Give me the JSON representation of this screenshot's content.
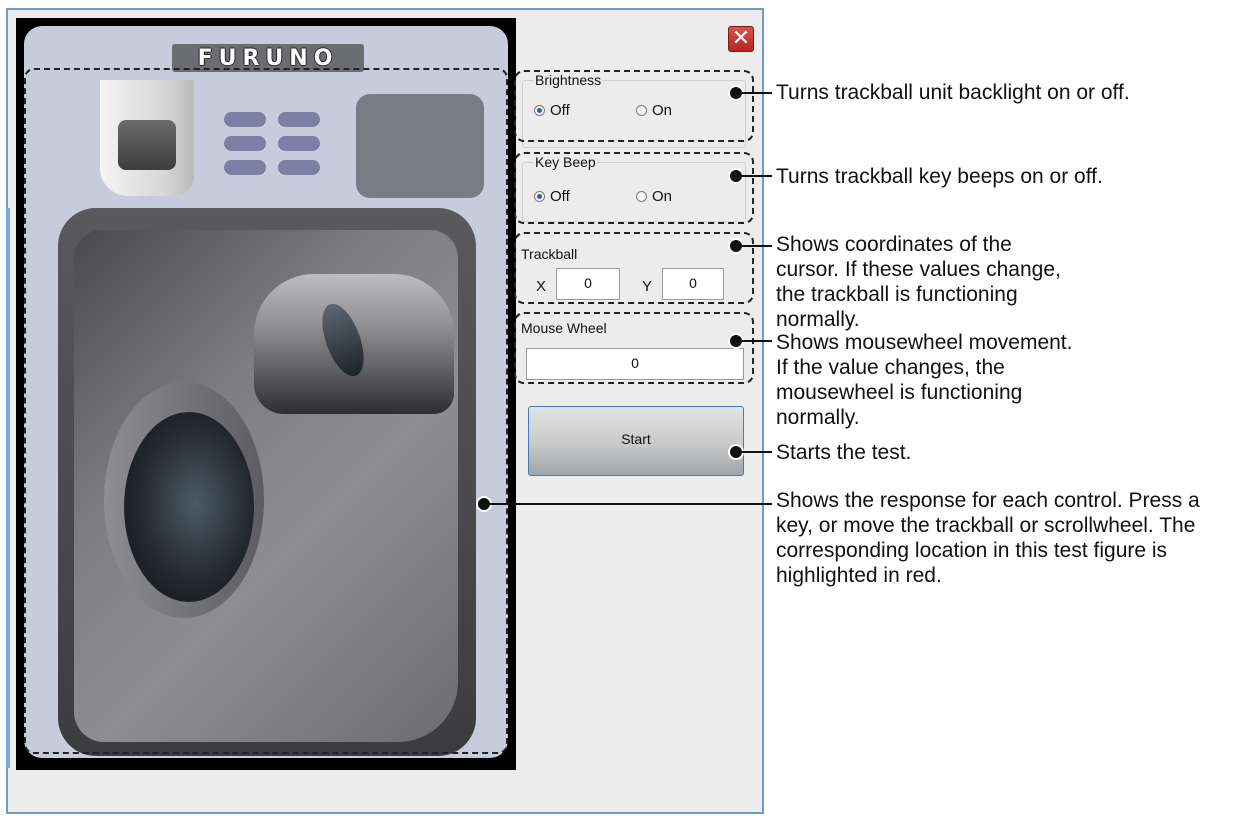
{
  "window": {
    "close_symbol": "✕",
    "logo_text": "FURUNO"
  },
  "brightness": {
    "label": "Brightness",
    "options": [
      {
        "label": "Off",
        "checked": true
      },
      {
        "label": "On",
        "checked": false
      }
    ]
  },
  "key_beep": {
    "label": "Key Beep",
    "options": [
      {
        "label": "Off",
        "checked": true
      },
      {
        "label": "On",
        "checked": false
      }
    ]
  },
  "trackball": {
    "label": "Trackball",
    "x_label": "X",
    "x_value": "0",
    "y_label": "Y",
    "y_value": "0"
  },
  "mouse_wheel": {
    "label": "Mouse Wheel",
    "value": "0"
  },
  "start_button": {
    "label": "Start"
  },
  "callouts": [
    {
      "text": "Turns trackball unit backlight on or off."
    },
    {
      "text": "Turns trackball key beeps on or off."
    },
    {
      "text": "Shows coordinates of the cursor. If these values change, the trackball is functioning normally."
    },
    {
      "text": "Shows mousewheel movement. If the value changes, the mousewheel is functioning normally."
    },
    {
      "text": "Starts the test."
    },
    {
      "text": "Shows the response for each control. Press a key, or move the trackball or scrollwheel. The corresponding location in this test figure is highlighted in red."
    }
  ],
  "colors": {
    "window_border": "#6e9ad0",
    "close_button": "#c9302c",
    "device_background": "#c7cbdc",
    "radio_checked": "#2f5fa5"
  }
}
